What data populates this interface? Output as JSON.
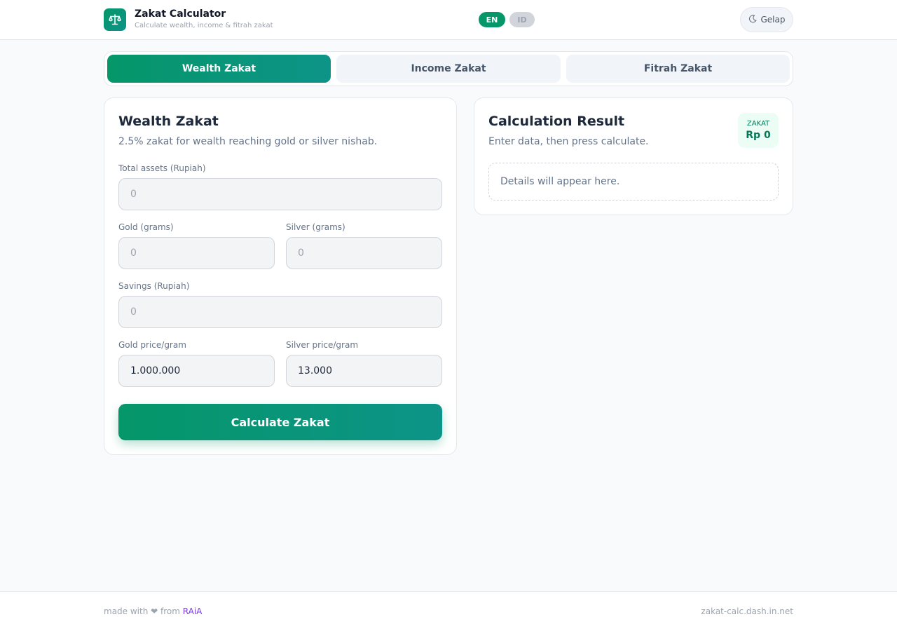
{
  "header": {
    "logo_icon": "scale-balance-icon",
    "title": "Zakat Calculator",
    "subtitle": "Calculate wealth, income & fitrah zakat",
    "lang_en": "EN",
    "lang_id": "ID",
    "theme_icon": "moon-icon",
    "theme_label": "Gelap"
  },
  "tabs": [
    {
      "label": "Wealth Zakat",
      "active": true
    },
    {
      "label": "Income Zakat",
      "active": false
    },
    {
      "label": "Fitrah Zakat",
      "active": false
    }
  ],
  "form": {
    "title": "Wealth Zakat",
    "description": "2.5% zakat for wealth reaching gold or silver nishab.",
    "total_assets": {
      "label": "Total assets (Rupiah)",
      "placeholder": "0",
      "value": ""
    },
    "gold": {
      "label": "Gold (grams)",
      "placeholder": "0",
      "value": ""
    },
    "silver": {
      "label": "Silver (grams)",
      "placeholder": "0",
      "value": ""
    },
    "savings": {
      "label": "Savings (Rupiah)",
      "placeholder": "0",
      "value": ""
    },
    "gold_price": {
      "label": "Gold price/gram",
      "placeholder": "",
      "value": "1.000.000"
    },
    "silver_price": {
      "label": "Silver price/gram",
      "placeholder": "",
      "value": "13.000"
    },
    "calculate_label": "Calculate Zakat"
  },
  "result": {
    "title": "Calculation Result",
    "description": "Enter data, then press calculate.",
    "badge_label": "ZAKAT",
    "badge_value": "Rp 0",
    "details": "Details will appear here."
  },
  "footer": {
    "made_with": "made with ❤ from",
    "brand": "RAiA",
    "domain": "zakat-calc.dash.in.net"
  },
  "colors": {
    "accent": "#059669",
    "accent_end": "#0d9488",
    "brand_link": "#7c3aed"
  }
}
